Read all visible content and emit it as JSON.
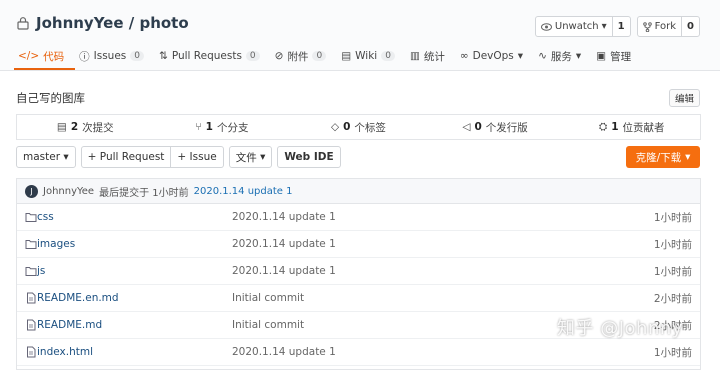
{
  "repo": {
    "name": "JohnnyYee / photo"
  },
  "actions": {
    "watch_label": "Unwatch",
    "watch_count": "1",
    "fork_label": "Fork",
    "fork_count": "0"
  },
  "tabs": [
    {
      "label": "代码",
      "icon": "code-icon"
    },
    {
      "label": "Issues",
      "badge": "0",
      "icon": "issue-icon"
    },
    {
      "label": "Pull Requests",
      "badge": "0",
      "icon": "pull-request-icon"
    },
    {
      "label": "附件",
      "badge": "0",
      "icon": "attachment-icon"
    },
    {
      "label": "Wiki",
      "badge": "0",
      "icon": "wiki-icon"
    },
    {
      "label": "统计",
      "icon": "stats-icon"
    },
    {
      "label": "DevOps",
      "icon": "devops-icon"
    },
    {
      "label": "服务",
      "icon": "service-icon"
    },
    {
      "label": "管理",
      "icon": "manage-icon"
    }
  ],
  "description": "自己写的图库",
  "edit_label": "编辑",
  "stats": [
    {
      "count": "2",
      "label": "次提交"
    },
    {
      "count": "1",
      "label": "个分支"
    },
    {
      "count": "0",
      "label": "个标签"
    },
    {
      "count": "0",
      "label": "个发行版"
    },
    {
      "count": "1",
      "label": "位贡献者"
    }
  ],
  "toolbar": {
    "branch": "master",
    "pull_request": "+ Pull Request",
    "issue": "+ Issue",
    "file": "文件",
    "webide": "Web IDE",
    "clone": "克隆/下载"
  },
  "last_commit": {
    "avatar": "J",
    "author": "JohnnyYee",
    "text": "最后提交于 1小时前",
    "message": "2020.1.14 update 1"
  },
  "files": [
    {
      "name": "css",
      "type": "folder",
      "message": "2020.1.14 update 1",
      "time": "1小时前"
    },
    {
      "name": "images",
      "type": "folder",
      "message": "2020.1.14 update 1",
      "time": "1小时前"
    },
    {
      "name": "js",
      "type": "folder",
      "message": "2020.1.14 update 1",
      "time": "1小时前"
    },
    {
      "name": "README.en.md",
      "type": "file",
      "message": "Initial commit",
      "time": "2小时前"
    },
    {
      "name": "README.md",
      "type": "file",
      "message": "Initial commit",
      "time": "2小时前"
    },
    {
      "name": "index.html",
      "type": "file",
      "message": "2020.1.14 update 1",
      "time": "1小时前"
    }
  ],
  "watermark": "知乎 @Johnny",
  "colors": {
    "accent": "#e8620d",
    "clone_button": "#f56e0f",
    "link": "#1b6fb3"
  }
}
